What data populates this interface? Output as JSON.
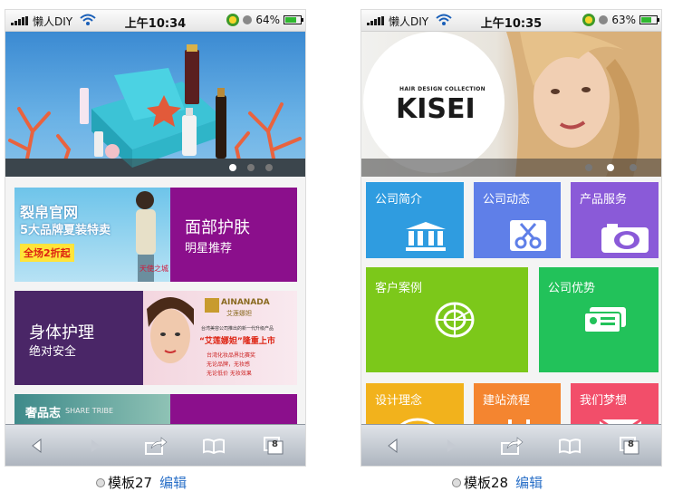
{
  "status_bar": {
    "carrier": "懒人DIY"
  },
  "phone_left": {
    "time": "上午10:34",
    "battery": "64%",
    "battery_level": 0.64,
    "promo_box": {
      "line1": "裂帛官网",
      "line2": "5大品牌夏装特卖",
      "badge": "全场2折起",
      "tag": "天使之城"
    },
    "tiles": [
      {
        "title": "面部护肤",
        "subtitle": "明星推荐"
      },
      {
        "title": "身体护理",
        "subtitle": "绝对安全"
      }
    ],
    "ad": {
      "brand": "AINANADA",
      "brand_cn": "艾莲娜妲",
      "line1": "台湾美容公司推出的新一代升级产品",
      "headline": "“艾莲娜妲”隆重上市",
      "line3": "台湾化妆品界比赛奖",
      "line4": "无论品牌，无妆感",
      "line5": "无论低价 无妆效果"
    },
    "partial_tile": {
      "title": "奢品志",
      "subtitle": "SHARE TRIBE"
    },
    "caption": {
      "label": "模板27",
      "edit": "编辑"
    }
  },
  "phone_right": {
    "time": "上午10:35",
    "battery": "63%",
    "battery_level": 0.63,
    "banner": {
      "small_text": "HAIR DESIGN COLLECTION",
      "brand": "KISEI"
    },
    "tiles": [
      {
        "label": "公司简介",
        "icon": "building-icon",
        "color": "#2f9ce0"
      },
      {
        "label": "公司动态",
        "icon": "scissors-icon",
        "color": "#5f7fe8"
      },
      {
        "label": "产品服务",
        "icon": "camera-icon",
        "color": "#8a5ad8"
      },
      {
        "label": "客户案例",
        "icon": "radar-icon",
        "color": "#7cc81a"
      },
      {
        "label": "公司优势",
        "icon": "id-card-icon",
        "color": "#22c25a"
      },
      {
        "label": "设计理念",
        "icon": "design-icon",
        "color": "#f2b21c"
      },
      {
        "label": "建站流程",
        "icon": "flow-icon",
        "color": "#f48530"
      },
      {
        "label": "我们梦想",
        "icon": "mail-icon",
        "color": "#f24e6a"
      }
    ],
    "caption": {
      "label": "模板28",
      "edit": "编辑"
    }
  },
  "browser_toolbar": {
    "icons": [
      "back-icon",
      "forward-icon",
      "share-icon",
      "bookmarks-icon",
      "tabs-icon"
    ],
    "tab_count": "8"
  },
  "colors": {
    "purple": "#8b0f8c",
    "dark_purple": "#4a2667",
    "banner_blue": "#4a9bd8"
  }
}
